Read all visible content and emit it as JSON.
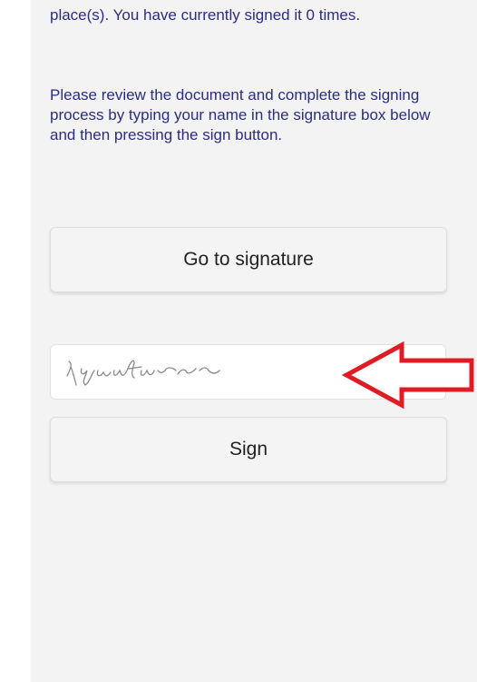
{
  "message": {
    "top_fragment": "place(s). You have currently signed it 0 times.",
    "main_text": "Please review the document and complete the signing process by typing your name in the signature box below and then pressing the sign button."
  },
  "buttons": {
    "go_to_signature": "Go to signature",
    "sign": "Sign"
  },
  "signature_input": {
    "placeholder": "signature",
    "value": ""
  },
  "colors": {
    "text": "#2b2d84",
    "arrow": "#e01b23",
    "panel_background": "#f3f3f3"
  },
  "icons": {
    "annotation": "red-arrow-left-icon"
  }
}
